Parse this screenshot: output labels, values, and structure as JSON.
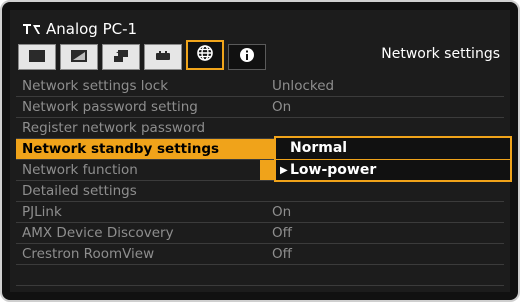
{
  "header": {
    "input_label": "Analog PC-1",
    "input_icon": "input-source-icon"
  },
  "tabs": [
    {
      "icon": "screen-icon",
      "active": false
    },
    {
      "icon": "image-adjust-icon",
      "active": false
    },
    {
      "icon": "install-icon",
      "active": false
    },
    {
      "icon": "system-icon",
      "active": false
    },
    {
      "icon": "network-globe-icon",
      "active": true
    },
    {
      "icon": "info-icon",
      "active": false
    }
  ],
  "tab_title": "Network settings",
  "menu": [
    {
      "label": "Network settings lock",
      "value": "Unlocked"
    },
    {
      "label": "Network password setting",
      "value": "On"
    },
    {
      "label": "Register network password",
      "value": ""
    },
    {
      "label": "Network standby settings",
      "value": ""
    },
    {
      "label": "Network function",
      "value": ""
    },
    {
      "label": "Detailed settings",
      "value": ""
    },
    {
      "label": "PJLink",
      "value": "On"
    },
    {
      "label": "AMX Device Discovery",
      "value": "Off"
    },
    {
      "label": "Crestron RoomView",
      "value": "Off"
    }
  ],
  "popup": {
    "options": [
      "Normal",
      "Low-power"
    ],
    "current_index": 1
  },
  "colors": {
    "accent": "#f0a31a",
    "background": "#1c1c1c",
    "text_dim": "#8e8e8e"
  }
}
